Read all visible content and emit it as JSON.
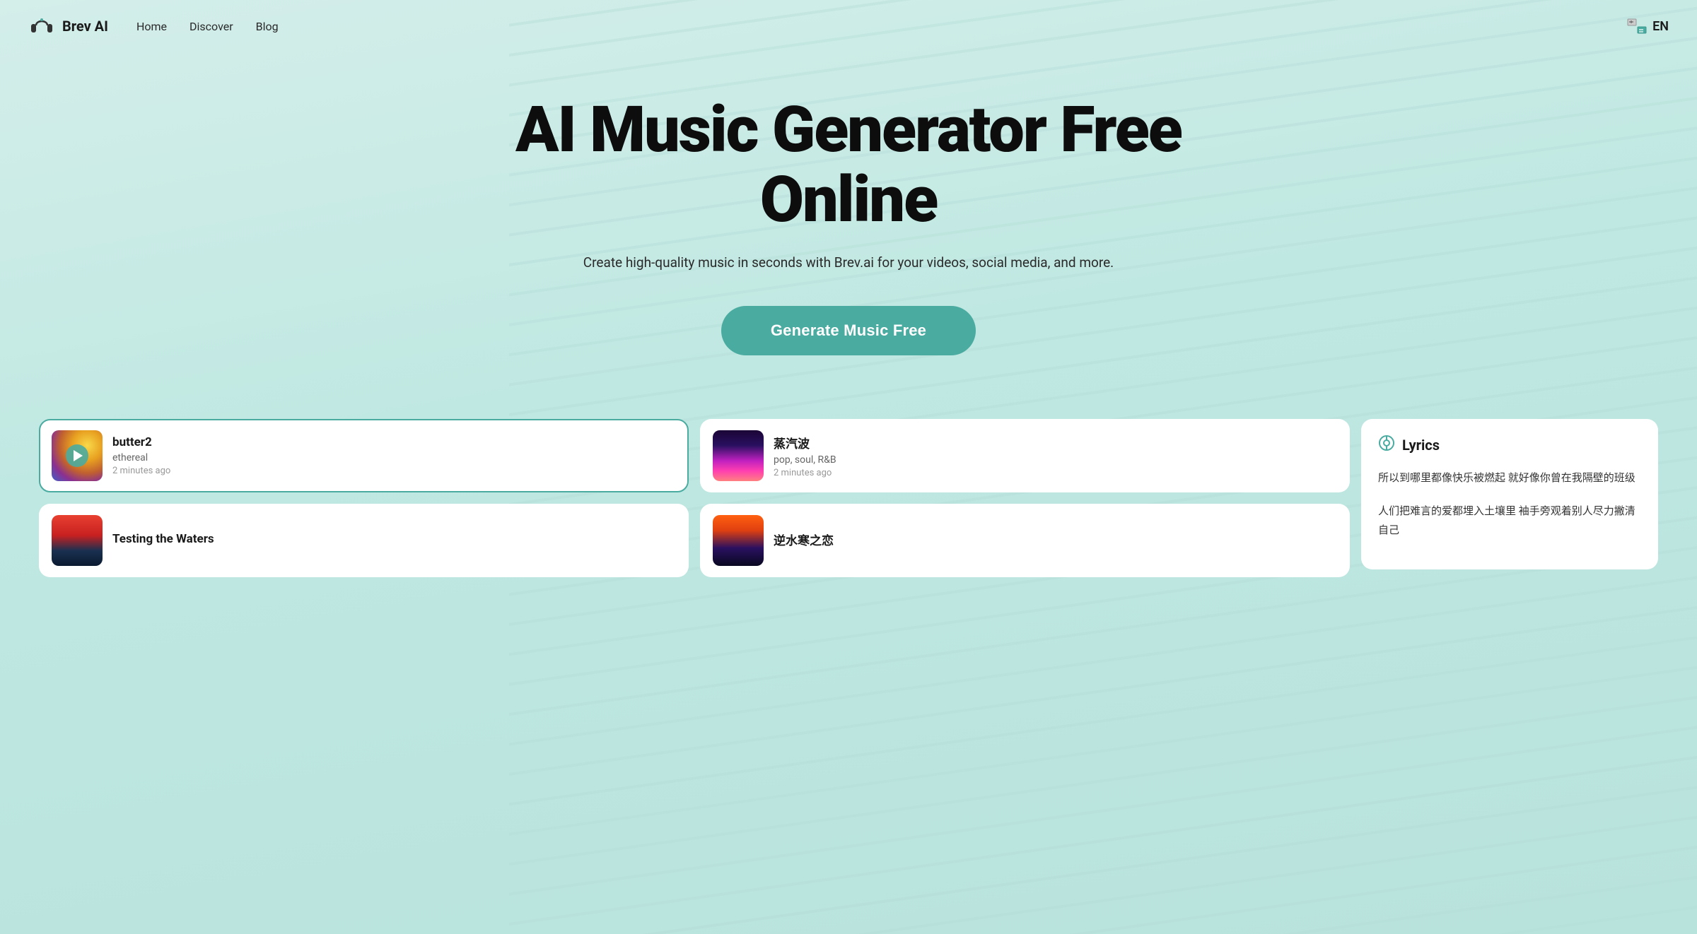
{
  "app": {
    "name": "Brev AI"
  },
  "nav": {
    "logo_text": "Brev AI",
    "links": [
      {
        "id": "home",
        "label": "Home"
      },
      {
        "id": "discover",
        "label": "Discover"
      },
      {
        "id": "blog",
        "label": "Blog"
      }
    ],
    "lang": "EN"
  },
  "hero": {
    "title": "AI Music Generator Free Online",
    "subtitle": "Create high-quality music in seconds with Brev.ai for your videos, social media, and more.",
    "cta_label": "Generate Music Free"
  },
  "cards": {
    "col1": [
      {
        "id": "butter2",
        "title": "butter2",
        "genre": "ethereal",
        "time": "2 minutes ago",
        "thumb": "butter2",
        "active": true
      },
      {
        "id": "testing",
        "title": "Testing the Waters",
        "genre": "",
        "time": "",
        "thumb": "testing",
        "active": false
      }
    ],
    "col2": [
      {
        "id": "steam",
        "title": "蒸汽波",
        "genre": "pop, soul, R&B",
        "time": "2 minutes ago",
        "thumb": "steam",
        "active": false
      },
      {
        "id": "niushui",
        "title": "逆水寒之恋",
        "genre": "",
        "time": "",
        "thumb": "niushui",
        "active": false
      }
    ]
  },
  "lyrics": {
    "title": "Lyrics",
    "paragraphs": [
      "所以到哪里都像快乐被燃起 就好像你曾在我隔壁的班级",
      "人们把难言的爱都埋入土壤里 袖手旁观着别人尽力撇清自己"
    ]
  }
}
